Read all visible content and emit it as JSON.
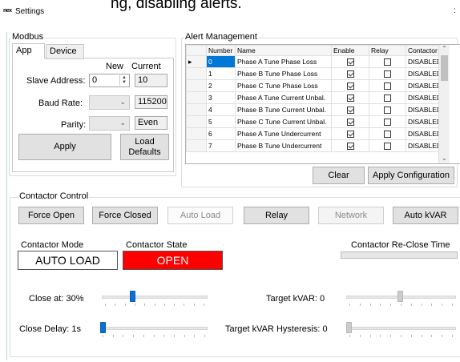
{
  "background_text": "ng, disabling alerts.",
  "window": {
    "title": "Settings",
    "icon": "app-logo-icon"
  },
  "modbus": {
    "group_title": "Modbus",
    "tabs": [
      "App",
      "Device"
    ],
    "col_new": "New",
    "col_current": "Current",
    "slave_address": {
      "label": "Slave Address:",
      "new_value": "0",
      "current_value": "10"
    },
    "baud_rate": {
      "label": "Baud Rate:",
      "new_value": "",
      "current_value": "115200"
    },
    "parity": {
      "label": "Parity:",
      "new_value": "",
      "current_value": "Even"
    },
    "apply_label": "Apply",
    "load_defaults_label": "Load\nDefaults"
  },
  "alert_management": {
    "group_title": "Alert Management",
    "columns": [
      "",
      "Number",
      "Name",
      "Enable",
      "Relay",
      "Contactor"
    ],
    "rows": [
      {
        "number": "0",
        "name": "Phase A Tune Phase Loss",
        "enable": true,
        "relay": false,
        "contactor": "DISABLED"
      },
      {
        "number": "1",
        "name": "Phase B Tune Phase Loss",
        "enable": true,
        "relay": false,
        "contactor": "DISABLED"
      },
      {
        "number": "2",
        "name": "Phase C Tune Phase Loss",
        "enable": true,
        "relay": false,
        "contactor": "DISABLED"
      },
      {
        "number": "3",
        "name": "Phase A Tune Current Unbal.",
        "enable": true,
        "relay": false,
        "contactor": "DISABLED"
      },
      {
        "number": "4",
        "name": "Phase B Tune Current Unbal.",
        "enable": true,
        "relay": false,
        "contactor": "DISABLED"
      },
      {
        "number": "5",
        "name": "Phase C Tune Current Unbal.",
        "enable": true,
        "relay": false,
        "contactor": "DISABLED"
      },
      {
        "number": "6",
        "name": "Phase A Tune Undercurrent",
        "enable": true,
        "relay": false,
        "contactor": "DISABLED"
      },
      {
        "number": "7",
        "name": "Phase B Tune Undercurrent",
        "enable": true,
        "relay": false,
        "contactor": "DISABLED"
      }
    ],
    "clear_label": "Clear",
    "apply_config_label": "Apply Configuration"
  },
  "contactor_control": {
    "group_title": "Contactor Control",
    "buttons": [
      {
        "label": "Force Open",
        "enabled": true
      },
      {
        "label": "Force Closed",
        "enabled": true
      },
      {
        "label": "Auto Load",
        "enabled": false
      },
      {
        "label": "Relay",
        "enabled": true
      },
      {
        "label": "Network",
        "enabled": false
      },
      {
        "label": "Auto kVAR",
        "enabled": true
      }
    ],
    "mode_label": "Contactor Mode",
    "mode_value": "AUTO LOAD",
    "state_label": "Contactor State",
    "state_value": "OPEN",
    "state_color": "#ff0000",
    "reclose_label": "Contactor Re-Close Time",
    "reclose_progress": 0,
    "close_at_label": "Close at: 30%",
    "close_at_value": 30,
    "close_delay_label": "Close Delay: 1s",
    "close_delay_value": 1,
    "target_kvar_label": "Target kVAR: 0",
    "target_kvar_value": 0,
    "target_kvar_hyst_label": "Target kVAR Hysteresis: 0",
    "target_kvar_hyst_value": 0
  },
  "colors": {
    "accent": "#0b6fd8",
    "state_open": "#ff0000"
  }
}
